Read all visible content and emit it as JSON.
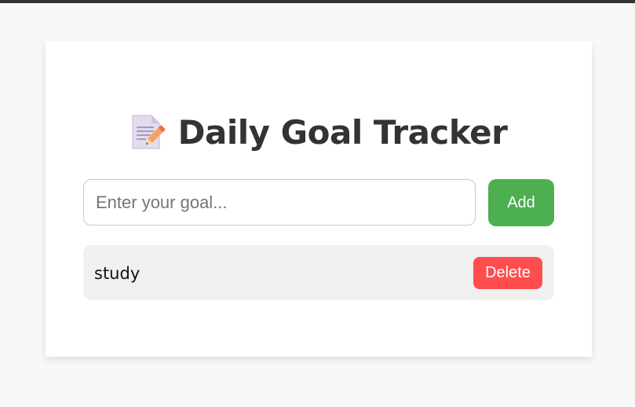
{
  "app": {
    "title": "Daily Goal Tracker",
    "title_icon": "memo-icon"
  },
  "input": {
    "placeholder": "Enter your goal...",
    "value": ""
  },
  "buttons": {
    "add_label": "Add",
    "delete_label": "Delete"
  },
  "goals": [
    {
      "text": "study"
    }
  ],
  "colors": {
    "add_button": "#4caf50",
    "delete_button": "#ff4d4d",
    "item_background": "#f0f0f0",
    "title_text": "#333333"
  }
}
